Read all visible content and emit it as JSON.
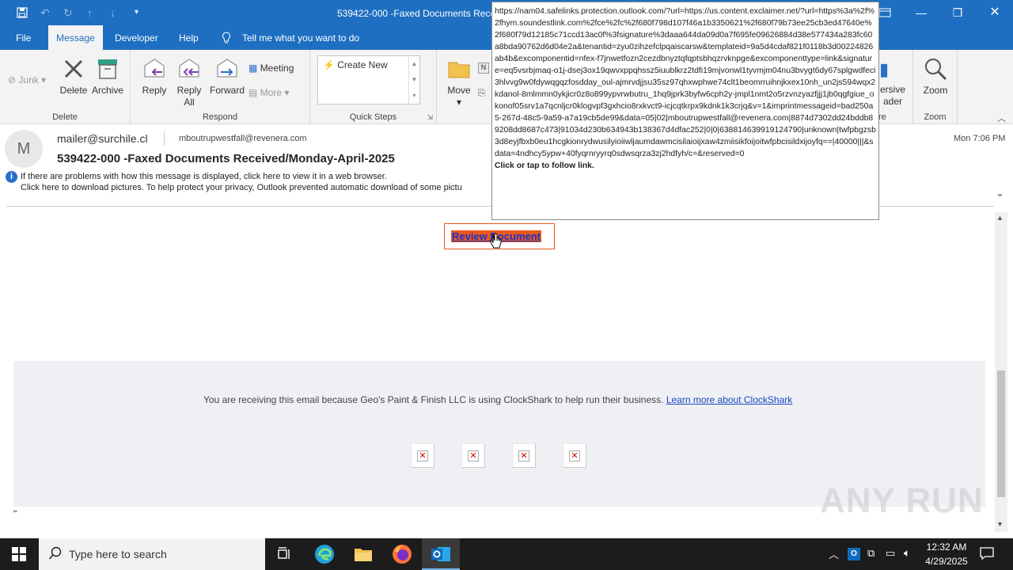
{
  "window": {
    "title": "539422-000 -Faxed Documents Received/Monday-April-2025 - Message (HTML)",
    "title_visible": "539422-000 -Faxed Documents Receiv"
  },
  "tabs": [
    {
      "label": "File"
    },
    {
      "label": "Message"
    },
    {
      "label": "Developer"
    },
    {
      "label": "Help"
    }
  ],
  "tell_me": "Tell me what you want to do",
  "ribbon": {
    "junk": "Junk",
    "delete": "Delete",
    "archive": "Archive",
    "delete_group": "Delete",
    "reply": "Reply",
    "reply_all_1": "Reply",
    "reply_all_2": "All",
    "forward": "Forward",
    "meeting": "Meeting",
    "more": "More",
    "respond_group": "Respond",
    "create_new": "Create New",
    "quick_steps_group": "Quick Steps",
    "move": "Move",
    "immersive_1": "ersive",
    "immersive_2": "ader",
    "immersive_group": "re",
    "zoom": "Zoom",
    "zoom_group": "Zoom"
  },
  "message": {
    "avatar_initial": "M",
    "from": "mailer@surchile.cl",
    "to": "mboutrupwestfall@revenera.com",
    "subject": "539422-000 -Faxed Documents Received/Monday-April-2025",
    "date": "Mon 7:06 PM",
    "info_line1": "If there are problems with how this message is displayed, click here to view it in a web browser.",
    "info_line2": "Click here to download pictures. To help protect your privacy, Outlook prevented automatic download of some pictu"
  },
  "body": {
    "review_button": "Review Document",
    "footer_text": "You are receiving this email because Geo's Paint & Finish LLC is using ClockShark to help run their business.",
    "footer_link": "Learn more about ClockShark",
    "stray_char": "\""
  },
  "tooltip": {
    "url": "https://nam04.safelinks.protection.outlook.com/?url=https://us.content.exclaimer.net/?url=https%3a%2f%2fhym.soundestlink.com%2fce%2fc%2f680f798d107f46a1b3350621%2f680f79b73ee25cb3ed47640e%2f680f79d12185c71ccd13ac0f%3fsignature%3daaa644da09d0a7f695fe09626884d38e577434a283fc60a8bda90762d6d04e2a&tenantid=zyu0zihzefclpqaiscarsw&templateid=9a5d4cdaf821f0118b3d00224826ab4b&excomponentid=nfex-f7jnwetfozn2cezdbnyztqfqptsbhqzrvknpge&excomponenttype=link&signature=eq5vsrbjmaq-o1j-dsej3ox19qwvxppqhssz5iuublkrz2tdfi19mjvonwl1tyvmjm04nu3bvygt6dy67splgwdfeci3hlvvg9w0fdywqgqzfosdday_oul-ajmrvdjjsu35sz97qhxwphwe74clt1beomrruihnjkxex10nh_un2js594wqx2kdanol-8mlmmn0ykjicr0z8o899ypvrwbutru_1hq9jprk3byfw6cph2y-jmpl1nmt2o5rzvnzyazfjjj1jb0qgfgiue_okonof05srv1a7qcnljcr0klogvpf3gxhcio8rxkvct9-icjcqtkrpx9kdnk1k3crjq&v=1&imprintmessageid=bad250a5-267d-48c5-9a59-a7a19cb5de99&data=05|02|mboutrupwestfall@revenera.com|8874d7302dd24bddb89208dd8687c473|91034d230b634943b138367d4dfac252|0|0|638814639919124790|unknown|twfpbgzsb3d8eyjfbxb0eu1hcgkionrydwusilyioiiwljaumdawmcisilaioijxaw4zmiisikfoijoitwfpbcisildxijoyfq==|40000|||&sdata=4ndhcy5ypw+40fyqrnryyrq0sdwsqrza3zj2hdfyh/c=&reserved=0",
    "hint": "Click or tap to follow link."
  },
  "taskbar": {
    "search_placeholder": "Type here to search",
    "time": "12:32 AM",
    "date": "4/29/2025"
  },
  "watermark": "ANY RUN",
  "colors": {
    "accent": "#1e6fc1",
    "review_bg": "#e8591a",
    "review_text": "#1a2fd4",
    "link": "#1a47c0"
  }
}
